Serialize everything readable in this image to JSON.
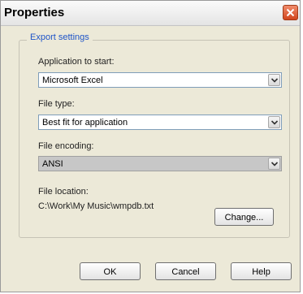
{
  "window": {
    "title": "Properties"
  },
  "group": {
    "legend": "Export settings"
  },
  "fields": {
    "application": {
      "label": "Application to start:",
      "value": "Microsoft Excel"
    },
    "file_type": {
      "label": "File type:",
      "value": "Best fit for application"
    },
    "file_encoding": {
      "label": "File encoding:",
      "value": "ANSI"
    },
    "file_location": {
      "label": "File location:",
      "value": "C:\\Work\\My Music\\wmpdb.txt"
    }
  },
  "buttons": {
    "change": "Change...",
    "ok": "OK",
    "cancel": "Cancel",
    "help": "Help"
  },
  "icons": {
    "close": "close-icon",
    "dropdown": "chevron-down-icon"
  }
}
